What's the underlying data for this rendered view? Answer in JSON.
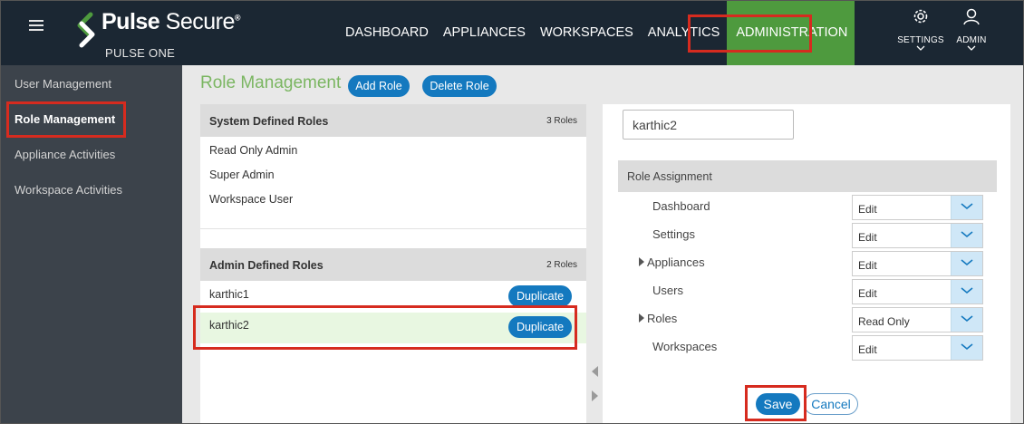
{
  "colors": {
    "accent": "#1479bf",
    "brand_green": "#4e9a3e",
    "highlight": "#d62b1f",
    "title_green": "#7bb662"
  },
  "header": {
    "brand_bold": "Pulse",
    "brand_light": "Secure",
    "brand_reg": "®",
    "subtitle": "PULSE ONE",
    "nav": [
      "DASHBOARD",
      "APPLIANCES",
      "WORKSPACES",
      "ANALYTICS",
      "ADMINISTRATION"
    ],
    "active_nav": "ADMINISTRATION",
    "settings_label": "SETTINGS",
    "admin_label": "ADMIN",
    "icons": [
      "menu-icon",
      "pulse-logo-icon",
      "gear-icon",
      "user-icon",
      "chevron-down-icon"
    ]
  },
  "sidebar": {
    "items": [
      "User Management",
      "Role Management",
      "Appliance Activities",
      "Workspace Activities"
    ],
    "active": "Role Management"
  },
  "main": {
    "title": "Role Management",
    "add_role": "Add Role",
    "delete_role": "Delete Role"
  },
  "system_roles": {
    "title": "System Defined Roles",
    "count": "3 Roles",
    "roles": [
      "Read Only Admin",
      "Super Admin",
      "Workspace User"
    ]
  },
  "admin_roles": {
    "title": "Admin Defined Roles",
    "count": "2 Roles",
    "roles": [
      "karthic1",
      "karthic2"
    ],
    "selected": "karthic2",
    "duplicate_label": "Duplicate"
  },
  "editor": {
    "role_name": "karthic2",
    "section_title": "Role Assignment",
    "permissions": [
      {
        "label": "Dashboard",
        "value": "Edit",
        "expandable": false
      },
      {
        "label": "Settings",
        "value": "Edit",
        "expandable": false
      },
      {
        "label": "Appliances",
        "value": "Edit",
        "expandable": true
      },
      {
        "label": "Users",
        "value": "Edit",
        "expandable": false
      },
      {
        "label": "Roles",
        "value": "Read Only",
        "expandable": true
      },
      {
        "label": "Workspaces",
        "value": "Edit",
        "expandable": false
      }
    ],
    "save": "Save",
    "cancel": "Cancel"
  }
}
